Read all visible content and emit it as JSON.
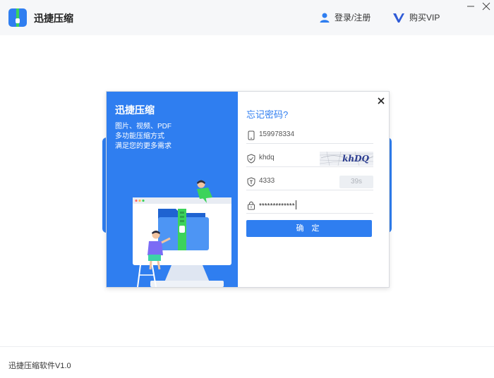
{
  "app": {
    "title": "迅捷压缩",
    "login_label": "登录/注册",
    "vip_label": "购买VIP"
  },
  "promo": {
    "title": "迅捷压缩",
    "lines": [
      "图片、视频、PDF",
      "多功能压缩方式",
      "满足您的更多需求"
    ]
  },
  "dialog": {
    "title": "忘记密码?",
    "phone_value": "159978334",
    "captcha_input_value": "khdq",
    "captcha_image_text": "khDQ",
    "sms_code_value": "4333",
    "countdown_label": "39s",
    "password_value": "*************",
    "confirm_label": "确 定"
  },
  "footer": {
    "version": "迅捷压缩软件V1.0"
  },
  "colors": {
    "accent": "#2f7ef0",
    "brand_green": "#3cd35b"
  },
  "icons": {
    "logo": "zip-logo-icon",
    "user": "user-icon",
    "vip": "vip-icon",
    "phone": "phone-icon",
    "shield": "shield-check-icon",
    "code": "shield-code-icon",
    "lock": "lock-icon"
  }
}
